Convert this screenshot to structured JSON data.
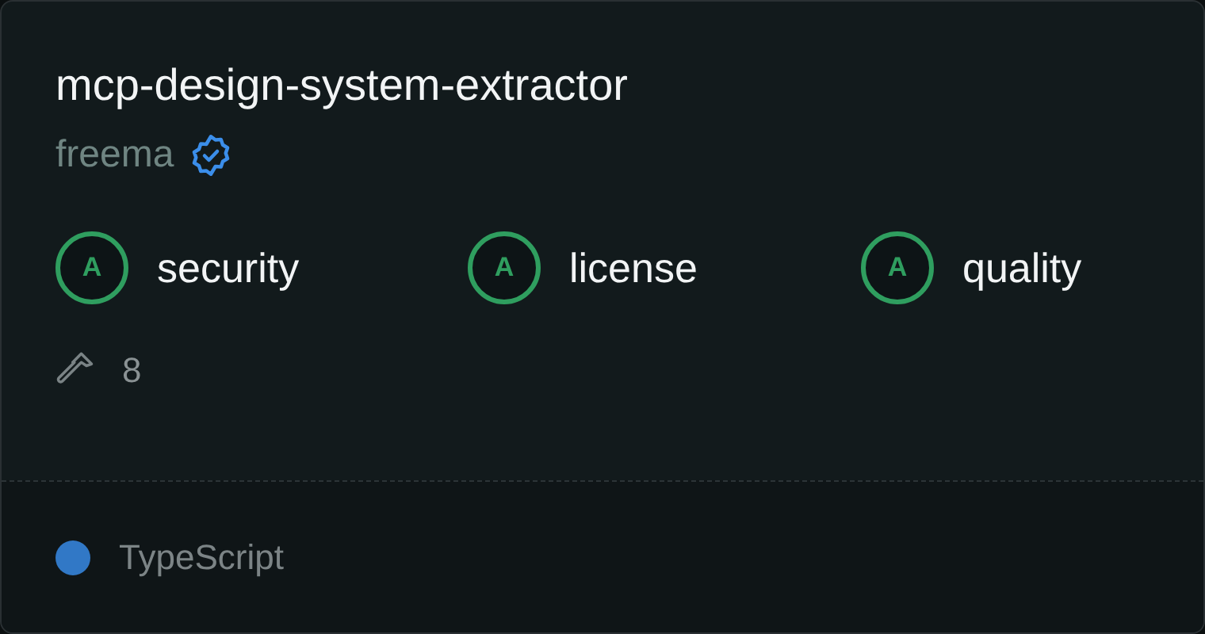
{
  "title": "mcp-design-system-extractor",
  "owner": {
    "name": "freema",
    "verified": true
  },
  "grades": [
    {
      "grade": "A",
      "label": "security",
      "color": "#2f9e5f"
    },
    {
      "grade": "A",
      "label": "license",
      "color": "#2f9e5f"
    },
    {
      "grade": "A",
      "label": "quality",
      "color": "#2f9e5f"
    }
  ],
  "tools_count": "8",
  "language": {
    "name": "TypeScript",
    "color": "#3178c6"
  }
}
